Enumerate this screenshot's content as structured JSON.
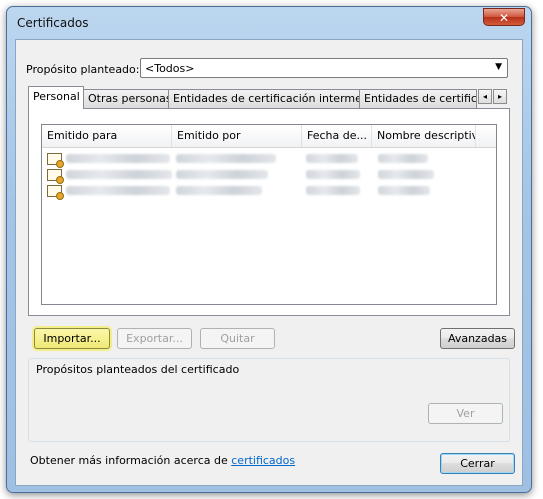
{
  "window": {
    "title": "Certificados",
    "close_icon": "✕"
  },
  "purpose": {
    "label": "Propósito planteado:",
    "value": "<Todos>"
  },
  "tabs": [
    {
      "label": "Personal",
      "active": true
    },
    {
      "label": "Otras personas",
      "active": false
    },
    {
      "label": "Entidades de certificación intermedias",
      "active": false
    },
    {
      "label": "Entidades de certificación",
      "active": false
    }
  ],
  "tab_scroll": {
    "left": "◂",
    "right": "▸"
  },
  "list": {
    "columns": [
      "Emitido para",
      "Emitido por",
      "Fecha de...",
      "Nombre descriptivo"
    ],
    "rows_count_note": ""
  },
  "buttons": {
    "import": "Importar...",
    "export": "Exportar...",
    "remove": "Quitar",
    "advanced": "Avanzadas",
    "view": "Ver",
    "close": "Cerrar"
  },
  "group": {
    "label": "Propósitos planteados del certificado"
  },
  "footer": {
    "text": "Obtener más información acerca de ",
    "link": "certificados"
  },
  "colors": {
    "link": "#0066cc",
    "focus": "#f3ee8a"
  }
}
